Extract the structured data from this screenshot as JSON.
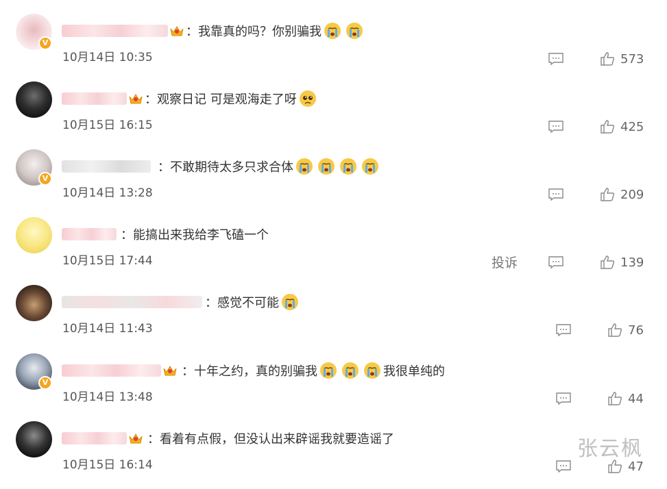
{
  "comments": [
    {
      "text_before": "我靠真的吗？你别骗我",
      "emojis_count": 2,
      "text_after": "",
      "date": "10月14日 10:35",
      "likes": "573",
      "verified": true,
      "crown": true
    },
    {
      "text_before": "观察日记 可是观海走了呀",
      "emojis_count": 1,
      "text_after": "",
      "date": "10月15日 16:15",
      "likes": "425",
      "verified": false,
      "crown": true
    },
    {
      "text_before": "不敢期待太多只求合体",
      "emojis_count": 4,
      "text_after": "",
      "date": "10月14日 13:28",
      "likes": "209",
      "verified": true,
      "crown": false
    },
    {
      "text_before": "能搞出来我给李飞磕一个",
      "emojis_count": 0,
      "text_after": "",
      "date": "10月15日 17:44",
      "likes": "139",
      "verified": false,
      "crown": false,
      "report": "投诉"
    },
    {
      "text_before": "感觉不可能",
      "emojis_count": 1,
      "text_after": "",
      "date": "10月14日 11:43",
      "likes": "76",
      "verified": false,
      "crown": false
    },
    {
      "text_before": "十年之约，真的别骗我",
      "emojis_count": 3,
      "text_after": "我很单纯的",
      "date": "10月14日 13:48",
      "likes": "44",
      "verified": true,
      "crown": true
    },
    {
      "text_before": "看着有点假，但没认出来辟谣我就要造谣了",
      "emojis_count": 0,
      "text_after": "",
      "date": "10月15日 16:14",
      "likes": "47",
      "verified": false,
      "crown": true
    }
  ],
  "watermark": "张云枫",
  "colors": {
    "verified": "#f7a51c",
    "icon_gray": "#888888",
    "text": "#333333"
  }
}
